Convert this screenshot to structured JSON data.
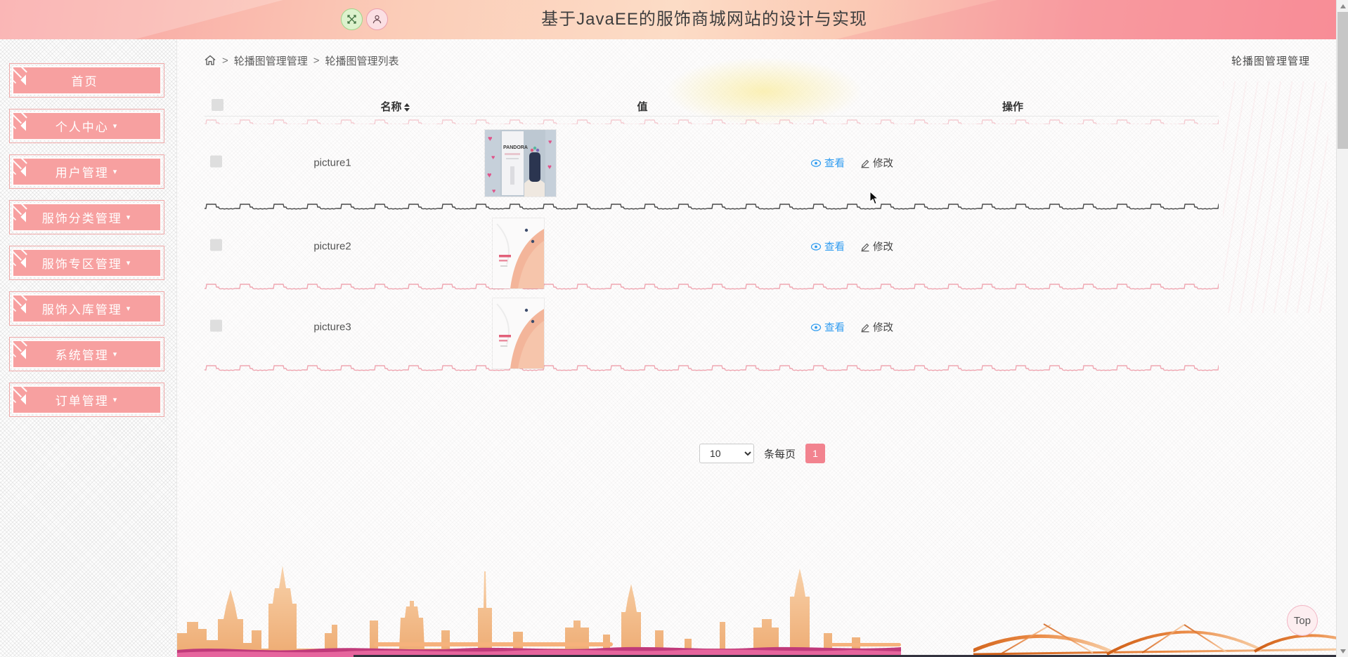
{
  "app": {
    "title": "基于JavaEE的服饰商城网站的设计与实现"
  },
  "header": {
    "fullscreen_icon": "fullscreen-expand",
    "user_icon": "user-profile"
  },
  "breadcrumb": {
    "separator": ">",
    "level1": "轮播图管理管理",
    "level2": "轮播图管理列表",
    "right_label": "轮播图管理管理"
  },
  "sidebar": {
    "items": [
      {
        "label": "首页",
        "caret": ""
      },
      {
        "label": "个人中心",
        "caret": "▾"
      },
      {
        "label": "用户管理",
        "caret": "▾"
      },
      {
        "label": "服饰分类管理",
        "caret": "▾"
      },
      {
        "label": "服饰专区管理",
        "caret": "▾"
      },
      {
        "label": "服饰入库管理",
        "caret": "▾"
      },
      {
        "label": "系统管理",
        "caret": "▾"
      },
      {
        "label": "订单管理",
        "caret": "▾"
      }
    ]
  },
  "table": {
    "header": {
      "name": "名称",
      "value": "值",
      "ops": "操作"
    },
    "rows": [
      {
        "name": "picture1",
        "image": "carousel-banner-1",
        "view": "查看",
        "edit": "修改"
      },
      {
        "name": "picture2",
        "image": "carousel-banner-2",
        "view": "查看",
        "edit": "修改"
      },
      {
        "name": "picture3",
        "image": "carousel-banner-3",
        "view": "查看",
        "edit": "修改"
      }
    ]
  },
  "pagination": {
    "page_size": "10",
    "per_page_label": "条每页",
    "current_page": "1"
  },
  "back_to_top": {
    "label": "Top"
  },
  "colors": {
    "sidebar_button": "#f7a0a0",
    "header_pink": "#f9a2a2",
    "link_blue": "#2e9bf0",
    "page_button": "#f2838f",
    "skyline_orange": "#f2bb88",
    "ribbon_magenta": "#c03a7a"
  }
}
